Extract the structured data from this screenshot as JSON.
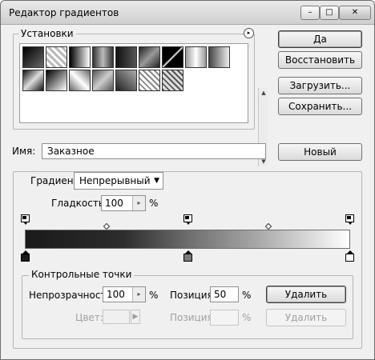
{
  "window": {
    "title": "Редактор градиентов",
    "controls": {
      "minimize": "–",
      "maximize": "□",
      "close": "✕"
    }
  },
  "presets": {
    "label": "Установки",
    "menu_icon": "▸",
    "scroll_up": "▲",
    "scroll_down": "▼"
  },
  "buttons": {
    "ok": "Да",
    "reset": "Восстановить",
    "load": "Загрузить...",
    "save": "Сохранить...",
    "new": "Новый"
  },
  "name": {
    "label": "Имя:",
    "value": "Заказное"
  },
  "gradient": {
    "type_label": "Градиент:",
    "type_value": "Непрерывный",
    "smoothness_label": "Гладкость:",
    "smoothness_value": "100",
    "smoothness_unit": "%"
  },
  "stops": {
    "group_label": "Контрольные точки",
    "opacity_label": "Непрозрачность:",
    "opacity_value": "100",
    "opacity_unit": "%",
    "position_label": "Позиция:",
    "position_value": "50",
    "position_unit": "%",
    "delete_label": "Удалить",
    "color_label": "Цвет:",
    "color_position_label": "Позиция:",
    "color_position_unit": "%",
    "color_delete_label": "Удалить"
  },
  "icons": {
    "dropdown": "▼",
    "spin": "▸",
    "color_arrow": "▶"
  }
}
